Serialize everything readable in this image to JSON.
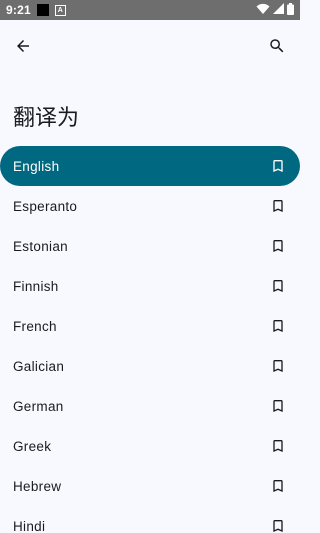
{
  "status_bar": {
    "time": "9:21",
    "notification_badge": "A"
  },
  "app_bar": {
    "back_icon": "arrow-back-icon",
    "search_icon": "search-icon"
  },
  "page": {
    "title": "翻译为"
  },
  "colors": {
    "selected_background": "#006880",
    "background": "#f8f9ff"
  },
  "languages": [
    {
      "label": "English",
      "selected": true
    },
    {
      "label": "Esperanto",
      "selected": false
    },
    {
      "label": "Estonian",
      "selected": false
    },
    {
      "label": "Finnish",
      "selected": false
    },
    {
      "label": "French",
      "selected": false
    },
    {
      "label": "Galician",
      "selected": false
    },
    {
      "label": "German",
      "selected": false
    },
    {
      "label": "Greek",
      "selected": false
    },
    {
      "label": "Hebrew",
      "selected": false
    },
    {
      "label": "Hindi",
      "selected": false
    }
  ]
}
